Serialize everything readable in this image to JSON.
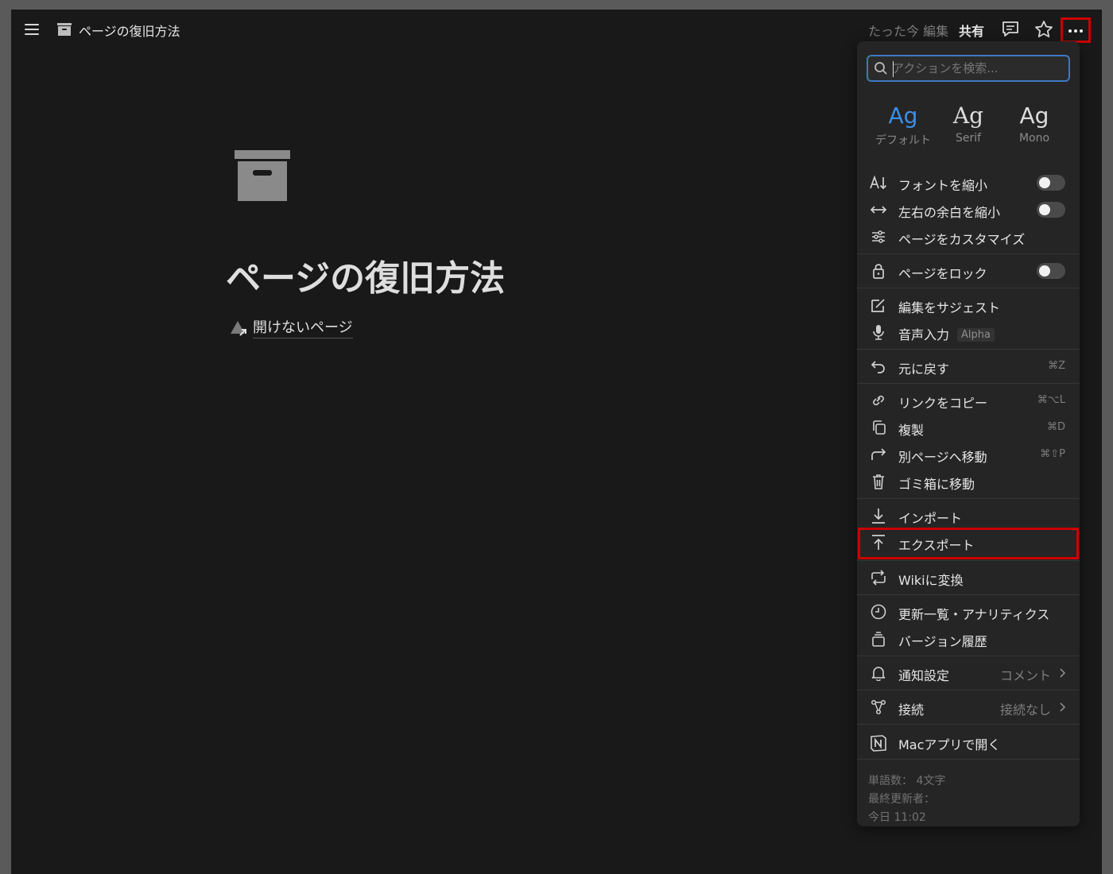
{
  "topbar": {
    "page_title": "ページの復旧方法",
    "edited": "たった今 編集",
    "share": "共有",
    "icons": [
      "menu-icon",
      "archive-icon",
      "comment-icon",
      "star-icon",
      "more-icon"
    ]
  },
  "page": {
    "title": "ページの復旧方法",
    "link_text": "開けないページ"
  },
  "menu": {
    "search_placeholder": "アクションを検索...",
    "fonts": [
      {
        "sample": "Ag",
        "label": "デフォルト"
      },
      {
        "sample": "Ag",
        "label": "Serif"
      },
      {
        "sample": "Ag",
        "label": "Mono"
      }
    ],
    "items": {
      "font_small": "フォントを縮小",
      "full_width": "左右の余白を縮小",
      "customize": "ページをカスタマイズ",
      "lock": "ページをロック",
      "suggest": "編集をサジェスト",
      "voice": "音声入力",
      "voice_badge": "Alpha",
      "undo": "元に戻す",
      "undo_sc": "⌘Z",
      "copy_link": "リンクをコピー",
      "copy_link_sc": "⌘⌥L",
      "duplicate": "複製",
      "duplicate_sc": "⌘D",
      "move": "別ページへ移動",
      "move_sc": "⌘⇧P",
      "trash": "ゴミ箱に移動",
      "import": "インポート",
      "export": "エクスポート",
      "wiki": "Wikiに変換",
      "updates": "更新一覧・アナリティクス",
      "history": "バージョン履歴",
      "notify": "通知設定",
      "notify_val": "コメント",
      "connect": "接続",
      "connect_val": "接続なし",
      "mac_app": "Macアプリで開く"
    },
    "footer": {
      "word_count": "単語数： 4文字",
      "last_editor": "最終更新者：",
      "updated": "今日 11:02"
    }
  }
}
